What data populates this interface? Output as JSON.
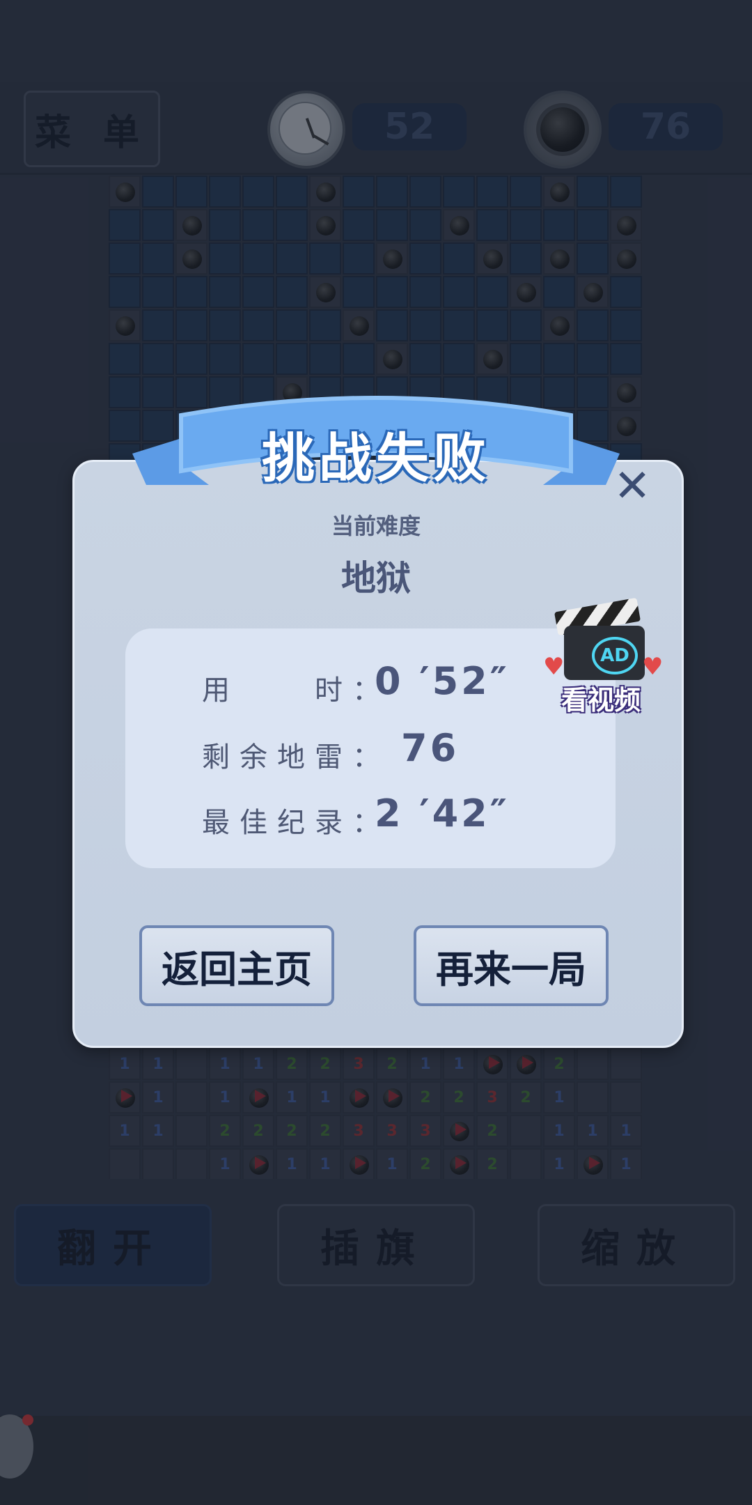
{
  "header": {
    "menu_label": "菜 单",
    "time_value": "52",
    "mines_value": "76"
  },
  "board": {
    "cols": 16,
    "top_rows": [
      "M.....M......M..",
      "..M...M...M....M",
      "..M.....M..M.M.M",
      "......M.....M.M.",
      "M......M.....M..",
      "........M..M....",
      ".....M.........M",
      "...............M",
      "................"
    ],
    "bottom_rows": [
      [
        "1",
        "1",
        "",
        "1",
        "1",
        "2",
        "2",
        "3",
        "2",
        "1",
        "1",
        "F",
        "F",
        "2",
        "",
        ""
      ],
      [
        "F",
        "1",
        "",
        "1",
        "F",
        "1",
        "1",
        "F",
        "F",
        "2",
        "2",
        "3",
        "2",
        "1",
        "",
        ""
      ],
      [
        "1",
        "1",
        "",
        "2",
        "2",
        "2",
        "2",
        "3",
        "3",
        "3",
        "F",
        "2",
        "",
        "1",
        "1",
        "1"
      ],
      [
        "",
        "",
        "",
        "1",
        "F",
        "1",
        "1",
        "F",
        "1",
        "2",
        "F",
        "2",
        "",
        "1",
        "F",
        "1"
      ]
    ]
  },
  "dialog": {
    "title": "挑战失败",
    "difficulty_label": "当前难度",
    "difficulty_value": "地狱",
    "close": "✕",
    "stats": [
      {
        "label": "用　　时：",
        "value": "0 ′52″"
      },
      {
        "label": "剩余地雷：",
        "value": "76"
      },
      {
        "label": "最佳纪录：",
        "value": "2 ′42″"
      }
    ],
    "ad": {
      "badge": "AD",
      "label": "看视频"
    },
    "back_home": "返回主页",
    "play_again": "再来一局"
  },
  "toolbar": {
    "reveal": "翻开",
    "flag": "插旗",
    "zoom": "缩放"
  },
  "colors": {
    "cell_hidden": "#1d3556",
    "cell_revealed": "#353b49",
    "dialog_bg": "#c9d4e3",
    "accent": "#2a68b8"
  }
}
